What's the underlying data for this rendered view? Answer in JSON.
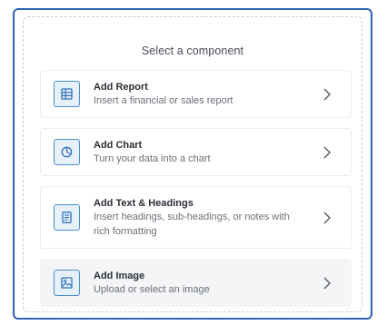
{
  "header": {
    "title": "Select a component"
  },
  "items": [
    {
      "title": "Add Report",
      "subtitle": "Insert a financial or sales report",
      "icon": "table-icon"
    },
    {
      "title": "Add Chart",
      "subtitle": "Turn your data into a chart",
      "icon": "pie-chart-icon"
    },
    {
      "title": "Add Text & Headings",
      "subtitle": "Insert headings, sub-headings, or notes with rich formatting",
      "icon": "document-icon"
    },
    {
      "title": "Add Image",
      "subtitle": "Upload or select an image",
      "icon": "image-icon"
    }
  ],
  "colors": {
    "frame_border": "#2f63b5",
    "icon_border": "#4a90d2",
    "icon_fill": "#e7f1fb",
    "hover_bg": "#f4f5f7"
  }
}
